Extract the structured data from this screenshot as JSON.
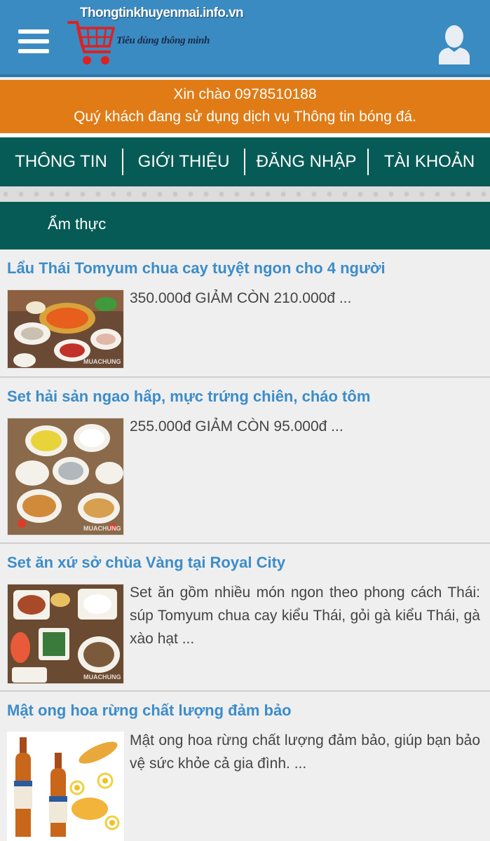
{
  "header": {
    "logo_domain": "Thongtinkhuyenmai.info.vn",
    "logo_slogan": "Tiêu dùng thông minh",
    "menu_icon": "hamburger-menu-icon",
    "user_icon": "user-avatar-icon"
  },
  "greeting": {
    "line1": "Xin chào 0978510188",
    "line2": "Quý khách đang sử dụng dịch vụ Thông tin bóng đá."
  },
  "nav": {
    "items": [
      {
        "label": "THÔNG TIN"
      },
      {
        "label": "GIỚI THIỆU"
      },
      {
        "label": "ĐĂNG NHẬP"
      },
      {
        "label": "TÀI KHOẢN"
      }
    ]
  },
  "category": {
    "title": "Ẩm thực"
  },
  "articles": [
    {
      "title": "Lẩu Thái Tomyum chua cay tuyệt ngon cho 4 người",
      "desc": "350.000đ GIẢM CÒN 210.000đ ...",
      "watermark": "MUACHUNG"
    },
    {
      "title": "Set hải sản ngao hấp, mực trứng chiên, cháo tôm",
      "desc": "255.000đ GIẢM CÒN 95.000đ ...",
      "watermark": "MUACHUNG"
    },
    {
      "title": "Set ăn xứ sở chùa Vàng tại Royal City",
      "desc": "Set ăn gồm nhiều món ngon theo phong cách Thái: súp Tomyum chua cay kiểu Thái, gỏi gà kiểu Thái, gà xào hạt ...",
      "watermark": "MUACHUNG"
    },
    {
      "title": "Mật ong hoa rừng chất lượng đảm bảo",
      "desc": "Mật ong hoa rừng chất lượng đảm bảo, giúp bạn bảo vệ sức khỏe cả gia đình. ..."
    }
  ],
  "colors": {
    "header_bg": "#3a8bc2",
    "greeting_bg": "#e07b16",
    "nav_bg": "#075b56",
    "title_color": "#3c8dc9"
  }
}
